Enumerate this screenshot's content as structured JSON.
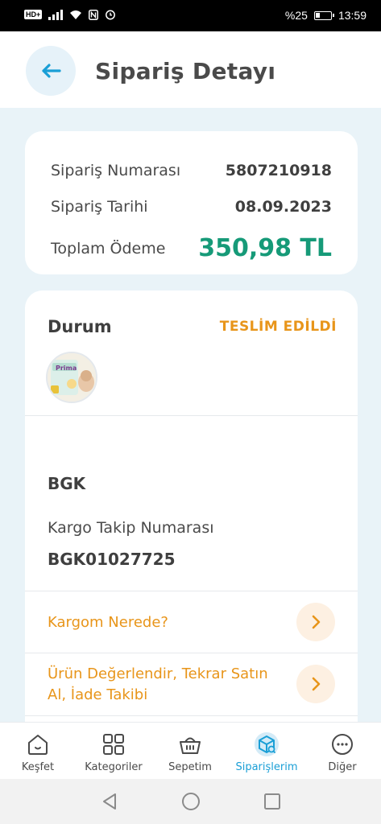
{
  "statusbar": {
    "left_badge": "HD+",
    "battery_percent": "%25",
    "time": "13:59"
  },
  "header": {
    "back_icon": "arrow-left-icon",
    "title": "Sipariş Detayı"
  },
  "summary": {
    "order_number_label": "Sipariş Numarası",
    "order_number": "5807210918",
    "order_date_label": "Sipariş Tarihi",
    "order_date": "08.09.2023",
    "total_label": "Toplam Ödeme",
    "total": "350,98 TL"
  },
  "detail": {
    "status_label": "Durum",
    "status_value": "TESLİM EDİLDİ",
    "product_image": "diaper-package-thumbnail",
    "cargo_company": "BGK",
    "tracking_label": "Kargo Takip Numarası",
    "tracking_number": "BGK01027725",
    "link_where": "Kargom Nerede?",
    "link_review_line1": "Ürün Değerlendir, Tekrar Satın",
    "link_review_line2": "Al, İade Takibi"
  },
  "bottom_nav": {
    "items": [
      {
        "label": "Keşfet",
        "icon": "home-icon"
      },
      {
        "label": "Kategoriler",
        "icon": "grid-icon"
      },
      {
        "label": "Sepetim",
        "icon": "basket-icon"
      },
      {
        "label": "Siparişlerim",
        "icon": "orders-box-icon",
        "active": true
      },
      {
        "label": "Diğer",
        "icon": "more-icon"
      }
    ]
  },
  "colors": {
    "accent_blue": "#1a9fd6",
    "status_orange": "#e8951a",
    "total_green": "#169a78",
    "background": "#e9f3f8"
  }
}
